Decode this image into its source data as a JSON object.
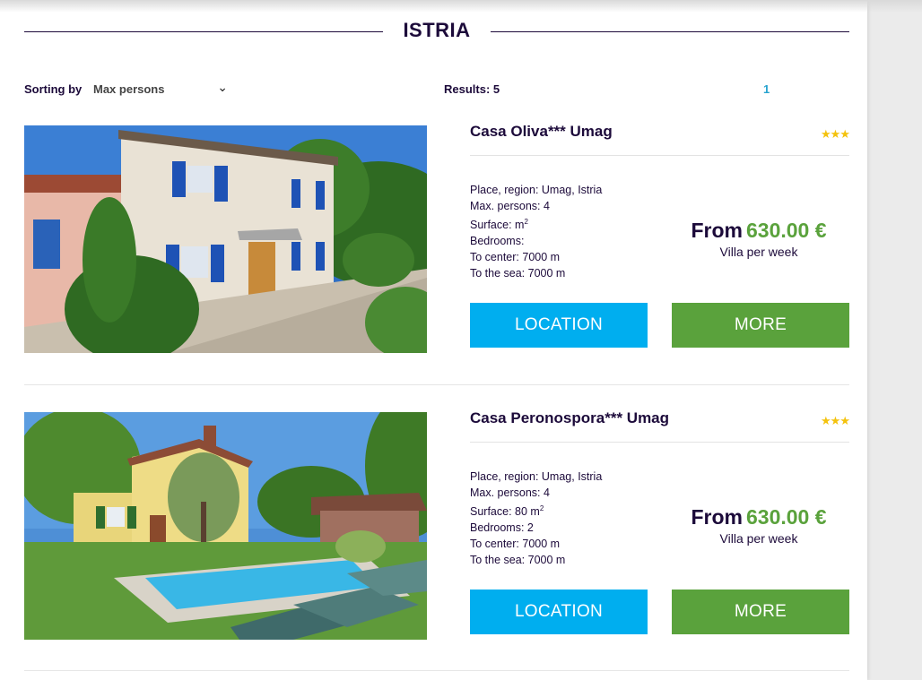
{
  "header": {
    "title": "ISTRIA"
  },
  "toolbar": {
    "sort_label": "Sorting by",
    "sort_value": "Max persons",
    "results": "Results: 5",
    "page": "1"
  },
  "listings": [
    {
      "title": "Casa Oliva*** Umag",
      "stars": "★★★",
      "place": "Place, region: Umag,  Istria",
      "persons": "Max. persons: 4",
      "surface": "Surface: m",
      "surface_unit": "2",
      "bedrooms": "Bedrooms:",
      "center": "To center: 7000 m",
      "sea": "To the sea: 7000 m",
      "price_from": "From",
      "price": "630.00 €",
      "price_note": "Villa per week",
      "btn_location": "LOCATION",
      "btn_more": "MORE"
    },
    {
      "title": "Casa Peronospora*** Umag",
      "stars": "★★★",
      "place": "Place, region: Umag,  Istria",
      "persons": "Max. persons: 4",
      "surface": "Surface: 80 m",
      "surface_unit": "2",
      "bedrooms": "Bedrooms: 2",
      "center": "To center: 7000 m",
      "sea": "To the sea: 7000 m",
      "price_from": "From",
      "price": "630.00 €",
      "price_note": "Villa per week",
      "btn_location": "LOCATION",
      "btn_more": "MORE"
    }
  ],
  "colors": {
    "accent_blue": "#00aeef",
    "accent_green": "#5aa23c",
    "title_dark": "#1c0a3a",
    "star_gold": "#f4c20d",
    "page_link": "#27a3cf"
  }
}
